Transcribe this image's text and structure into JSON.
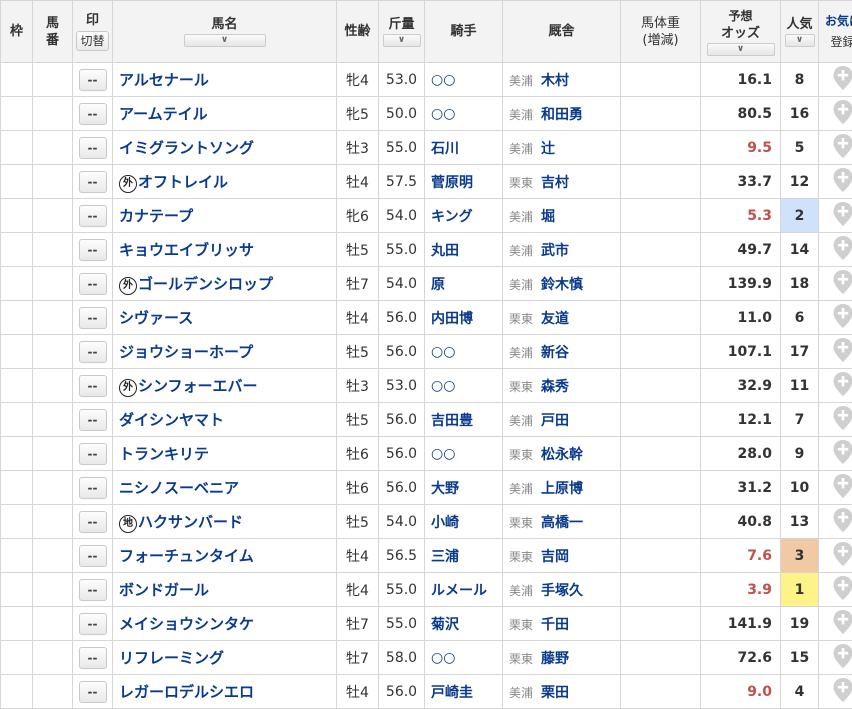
{
  "header": {
    "waku": "枠",
    "umaban": "馬\n番",
    "mark": "印",
    "mark_switch": "切替",
    "name": "馬名",
    "sort_caret": "∨",
    "sex_age": "性齢",
    "kinryo": "斤量",
    "jockey": "騎手",
    "stable": "厩舎",
    "weight_line1": "馬体重",
    "weight_line2": "(増減)",
    "odds_line1": "予想",
    "odds_line2": "オッズ",
    "pop": "人気",
    "fav_title": "お気に入",
    "fav_register": "登録"
  },
  "mark_placeholder": "--",
  "rows": [
    {
      "badge": "",
      "name": "アルセナール",
      "sex_age": "牝4",
      "kinryo": "53.0",
      "jockey": "○○",
      "region": "美浦",
      "trainer": "木村",
      "odds": "16.1",
      "odds_low": false,
      "pop": "8",
      "pop_rank": ""
    },
    {
      "badge": "",
      "name": "アームテイル",
      "sex_age": "牝5",
      "kinryo": "50.0",
      "jockey": "○○",
      "region": "美浦",
      "trainer": "和田勇",
      "odds": "80.5",
      "odds_low": false,
      "pop": "16",
      "pop_rank": ""
    },
    {
      "badge": "",
      "name": "イミグラントソング",
      "sex_age": "牡3",
      "kinryo": "55.0",
      "jockey": "石川",
      "region": "美浦",
      "trainer": "辻",
      "odds": "9.5",
      "odds_low": true,
      "pop": "5",
      "pop_rank": ""
    },
    {
      "badge": "外",
      "name": "オフトレイル",
      "sex_age": "牡4",
      "kinryo": "57.5",
      "jockey": "菅原明",
      "region": "栗東",
      "trainer": "吉村",
      "odds": "33.7",
      "odds_low": false,
      "pop": "12",
      "pop_rank": ""
    },
    {
      "badge": "",
      "name": "カナテープ",
      "sex_age": "牝6",
      "kinryo": "54.0",
      "jockey": "キング",
      "region": "美浦",
      "trainer": "堀",
      "odds": "5.3",
      "odds_low": true,
      "pop": "2",
      "pop_rank": "rank2"
    },
    {
      "badge": "",
      "name": "キョウエイブリッサ",
      "sex_age": "牡5",
      "kinryo": "55.0",
      "jockey": "丸田",
      "region": "美浦",
      "trainer": "武市",
      "odds": "49.7",
      "odds_low": false,
      "pop": "14",
      "pop_rank": ""
    },
    {
      "badge": "外",
      "name": "ゴールデンシロップ",
      "sex_age": "牡7",
      "kinryo": "54.0",
      "jockey": "原",
      "region": "美浦",
      "trainer": "鈴木慎",
      "odds": "139.9",
      "odds_low": false,
      "pop": "18",
      "pop_rank": ""
    },
    {
      "badge": "",
      "name": "シヴァース",
      "sex_age": "牡4",
      "kinryo": "56.0",
      "jockey": "内田博",
      "region": "栗東",
      "trainer": "友道",
      "odds": "11.0",
      "odds_low": false,
      "pop": "6",
      "pop_rank": ""
    },
    {
      "badge": "",
      "name": "ジョウショーホープ",
      "sex_age": "牡5",
      "kinryo": "56.0",
      "jockey": "○○",
      "region": "美浦",
      "trainer": "新谷",
      "odds": "107.1",
      "odds_low": false,
      "pop": "17",
      "pop_rank": ""
    },
    {
      "badge": "外",
      "name": "シンフォーエバー",
      "sex_age": "牡3",
      "kinryo": "53.0",
      "jockey": "○○",
      "region": "栗東",
      "trainer": "森秀",
      "odds": "32.9",
      "odds_low": false,
      "pop": "11",
      "pop_rank": ""
    },
    {
      "badge": "",
      "name": "ダイシンヤマト",
      "sex_age": "牡5",
      "kinryo": "56.0",
      "jockey": "吉田豊",
      "region": "美浦",
      "trainer": "戸田",
      "odds": "12.1",
      "odds_low": false,
      "pop": "7",
      "pop_rank": ""
    },
    {
      "badge": "",
      "name": "トランキリテ",
      "sex_age": "牡6",
      "kinryo": "56.0",
      "jockey": "○○",
      "region": "栗東",
      "trainer": "松永幹",
      "odds": "28.0",
      "odds_low": false,
      "pop": "9",
      "pop_rank": ""
    },
    {
      "badge": "",
      "name": "ニシノスーベニア",
      "sex_age": "牡6",
      "kinryo": "56.0",
      "jockey": "大野",
      "region": "美浦",
      "trainer": "上原博",
      "odds": "31.2",
      "odds_low": false,
      "pop": "10",
      "pop_rank": ""
    },
    {
      "badge": "地",
      "name": "ハクサンバード",
      "sex_age": "牡5",
      "kinryo": "54.0",
      "jockey": "小崎",
      "region": "栗東",
      "trainer": "高橋一",
      "odds": "40.8",
      "odds_low": false,
      "pop": "13",
      "pop_rank": ""
    },
    {
      "badge": "",
      "name": "フォーチュンタイム",
      "sex_age": "牡4",
      "kinryo": "56.5",
      "jockey": "三浦",
      "region": "栗東",
      "trainer": "吉岡",
      "odds": "7.6",
      "odds_low": true,
      "pop": "3",
      "pop_rank": "rank3"
    },
    {
      "badge": "",
      "name": "ボンドガール",
      "sex_age": "牝4",
      "kinryo": "55.0",
      "jockey": "ルメール",
      "region": "美浦",
      "trainer": "手塚久",
      "odds": "3.9",
      "odds_low": true,
      "pop": "1",
      "pop_rank": "rank1"
    },
    {
      "badge": "",
      "name": "メイショウシンタケ",
      "sex_age": "牡7",
      "kinryo": "55.0",
      "jockey": "菊沢",
      "region": "栗東",
      "trainer": "千田",
      "odds": "141.9",
      "odds_low": false,
      "pop": "19",
      "pop_rank": ""
    },
    {
      "badge": "",
      "name": "リフレーミング",
      "sex_age": "牡7",
      "kinryo": "58.0",
      "jockey": "○○",
      "region": "栗東",
      "trainer": "藤野",
      "odds": "72.6",
      "odds_low": false,
      "pop": "15",
      "pop_rank": ""
    },
    {
      "badge": "",
      "name": "レガーロデルシエロ",
      "sex_age": "牡4",
      "kinryo": "56.0",
      "jockey": "戸崎圭",
      "region": "美浦",
      "trainer": "栗田",
      "odds": "9.0",
      "odds_low": true,
      "pop": "4",
      "pop_rank": ""
    }
  ],
  "colors": {
    "name_link": "#0a3a8c",
    "low_odds": "#c0504d",
    "pop_rank1": "#fdf389",
    "pop_rank2": "#cfe1fb",
    "pop_rank3": "#f1c9a4",
    "fav_icon": "#cfcfcf"
  },
  "icons": {
    "fav": "map-pin-plus-icon"
  }
}
